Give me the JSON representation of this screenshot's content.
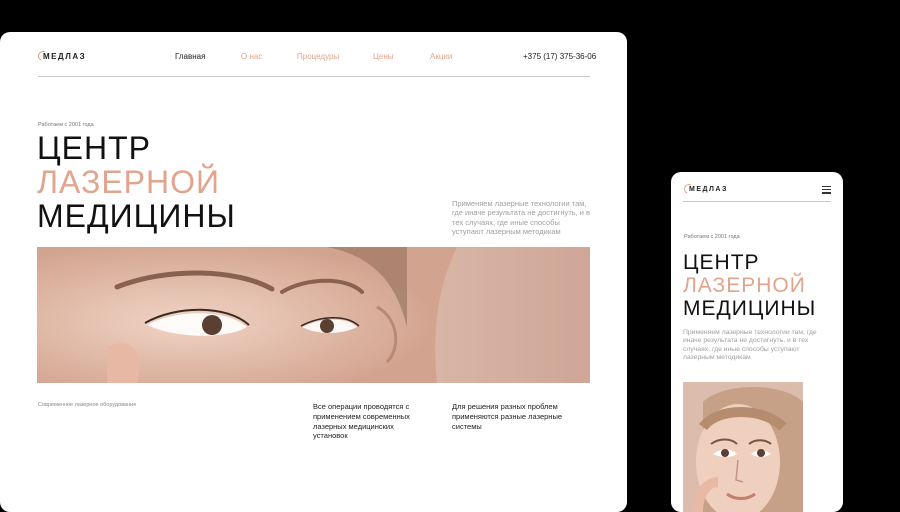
{
  "brand": {
    "logo_text": "МЕДЛАЗ"
  },
  "nav": [
    {
      "label": "Главная",
      "active": true
    },
    {
      "label": "О нас"
    },
    {
      "label": "Процедуры"
    },
    {
      "label": "Цены"
    },
    {
      "label": "Акции"
    }
  ],
  "phone": "+375 (17) 375-36-06",
  "hero": {
    "eyebrow": "Работаем с 2001 года",
    "title_line1": "ЦЕНТР",
    "title_line2": "ЛАЗЕРНОЙ",
    "title_line3": "МЕДИЦИНЫ",
    "lead": "Применяем лазерные технологии там, где иначе результата не достигнуть, и в тех случаях, где иные способы уступают лазерным методикам"
  },
  "features": {
    "caption": "Современное лазерное оборудование",
    "item1": "Все операции проводятся с применением современных лазерных медицинских установок",
    "item2": "Для решения разных проблем применяются разные лазерные системы"
  },
  "colors": {
    "accent": "#e2a48e",
    "text": "#111111",
    "muted": "#a0a0a0",
    "background": "#000000"
  },
  "icons": [
    "logo-mark-icon",
    "menu-icon"
  ]
}
